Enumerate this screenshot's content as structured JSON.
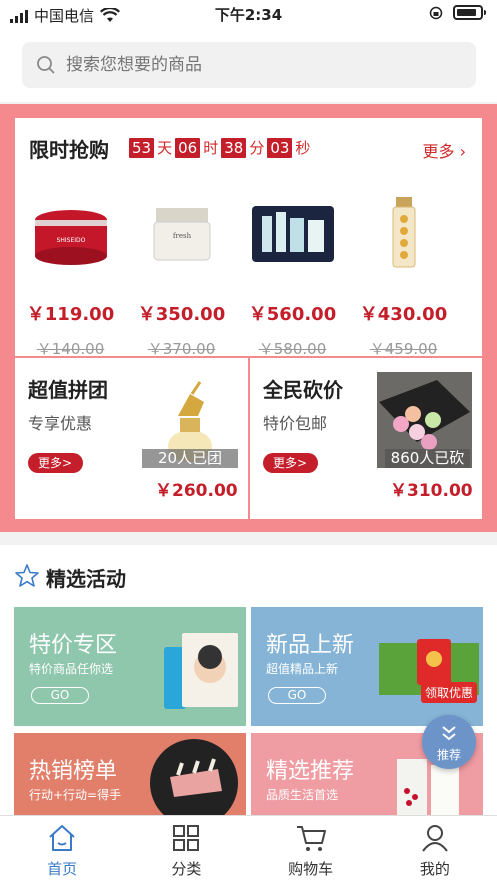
{
  "status_bar": {
    "carrier": "中国电信",
    "time": "下午2:34"
  },
  "search": {
    "placeholder": "搜索您想要的商品"
  },
  "flash_sale": {
    "title": "限时抢购",
    "countdown": {
      "days": "53",
      "days_unit": "天",
      "hours": "06",
      "hours_unit": "时",
      "minutes": "38",
      "minutes_unit": "分",
      "seconds": "03",
      "seconds_unit": "秒"
    },
    "more": "更多",
    "products": [
      {
        "price": "￥119.00",
        "original_price": "￥140.00",
        "image": "red-cream-jar"
      },
      {
        "price": "￥350.00",
        "original_price": "￥370.00",
        "image": "white-cream-jar"
      },
      {
        "price": "￥560.00",
        "original_price": "￥580.00",
        "image": "gift-box-set"
      },
      {
        "price": "￥430.00",
        "original_price": "￥459.00",
        "image": "capsule-bottle"
      }
    ]
  },
  "group_buy": {
    "title": "超值拼团",
    "subtitle": "专享优惠",
    "button": "更多>",
    "count": "20人已团",
    "price": "￥260.00"
  },
  "bargain": {
    "title": "全民砍价",
    "subtitle": "特价包邮",
    "button": "更多>",
    "count": "860人已砍",
    "price": "￥310.00"
  },
  "activities": {
    "title": "精选活动",
    "cards": [
      {
        "title": "特价专区",
        "subtitle": "特价商品任你选",
        "button": "GO",
        "color": "#8fc7ad"
      },
      {
        "title": "新品上新",
        "subtitle": "超值精品上新",
        "button": "GO",
        "color": "#85b4d6",
        "badge": "领取优惠"
      },
      {
        "title": "热销榜单",
        "subtitle": "行动+行动=得手",
        "color": "#e17f6b"
      },
      {
        "title": "精选推荐",
        "subtitle": "品质生活首选",
        "color": "#f09ca3"
      }
    ]
  },
  "float_button": {
    "label": "推荐"
  },
  "tabbar": [
    {
      "label": "首页",
      "icon": "home-icon",
      "active": true
    },
    {
      "label": "分类",
      "icon": "grid-icon"
    },
    {
      "label": "购物车",
      "icon": "cart-icon"
    },
    {
      "label": "我的",
      "icon": "user-icon"
    }
  ],
  "colors": {
    "accent_red": "#c41e2a",
    "promo_bg": "#f58a8e",
    "tab_active": "#3a7bc8"
  }
}
